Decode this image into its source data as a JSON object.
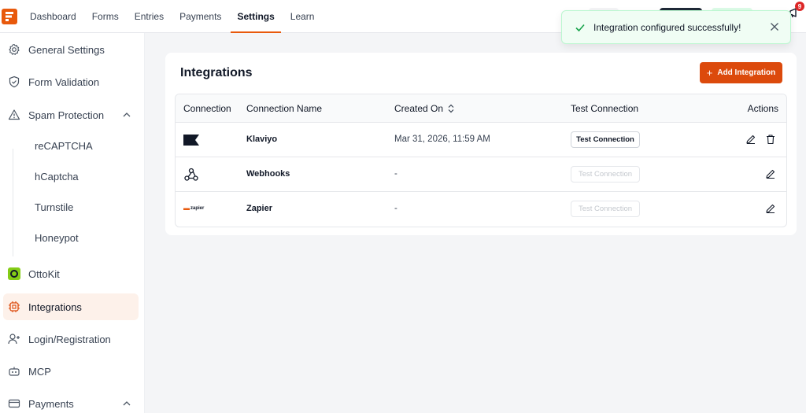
{
  "nav": {
    "items": [
      {
        "label": "Dashboard"
      },
      {
        "label": "Forms"
      },
      {
        "label": "Entries"
      },
      {
        "label": "Payments"
      },
      {
        "label": "Settings",
        "active": true
      },
      {
        "label": "Learn"
      }
    ]
  },
  "notifications": {
    "count": "9"
  },
  "sidebar": {
    "items": [
      {
        "label": "General Settings",
        "icon": "gear-icon"
      },
      {
        "label": "Form Validation",
        "icon": "shield-check-icon"
      },
      {
        "label": "Spam Protection",
        "icon": "warning-icon",
        "expanded": true
      },
      {
        "label": "OttoKit",
        "icon": "ottokit-icon"
      },
      {
        "label": "Integrations",
        "icon": "integrations-icon",
        "active": true
      },
      {
        "label": "Login/Registration",
        "icon": "user-plus-icon"
      },
      {
        "label": "MCP",
        "icon": "robot-icon"
      },
      {
        "label": "Payments",
        "icon": "card-icon",
        "expanded": true
      }
    ],
    "spam_sub": [
      "reCAPTCHA",
      "hCaptcha",
      "Turnstile",
      "Honeypot"
    ]
  },
  "main": {
    "title": "Integrations",
    "add_label": "Add Integration",
    "columns": [
      "Connection",
      "Connection Name",
      "Created On",
      "Test Connection",
      "Actions"
    ],
    "rows": [
      {
        "logo": "klaviyo-logo",
        "name": "Klaviyo",
        "created": "Mar 31, 2026, 11:59 AM",
        "test": "Test Connection",
        "test_enabled": true,
        "deletable": true
      },
      {
        "logo": "webhooks-logo",
        "name": "Webhooks",
        "created": "-",
        "test": "Test Connection",
        "test_enabled": false,
        "deletable": false
      },
      {
        "logo": "zapier-logo",
        "name": "Zapier",
        "created": "-",
        "test": "Test Connection",
        "test_enabled": false,
        "deletable": false
      }
    ],
    "zapier_mark": "zapier"
  },
  "toast": {
    "message": "Integration configured successfully!"
  },
  "colors": {
    "accent": "#e8590c",
    "button": "#dc4a0c",
    "success": "#16a34a"
  }
}
